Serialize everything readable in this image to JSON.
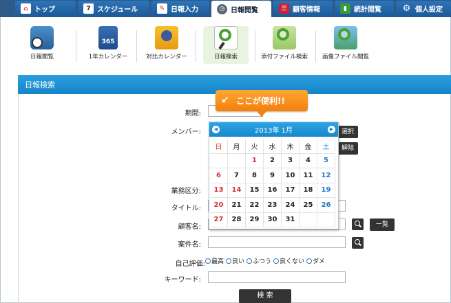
{
  "tabs": [
    {
      "label": "トップ",
      "icon": "home-icon",
      "active": false
    },
    {
      "label": "スケジュール",
      "icon": "calendar-icon",
      "active": false
    },
    {
      "label": "日報入力",
      "icon": "edit-icon",
      "active": false
    },
    {
      "label": "日報閲覧",
      "icon": "clock-icon",
      "active": true
    },
    {
      "label": "顧客情報",
      "icon": "customer-icon",
      "active": false
    },
    {
      "label": "統計閲覧",
      "icon": "stats-icon",
      "active": false
    },
    {
      "label": "個人設定",
      "icon": "gear-icon",
      "active": false
    }
  ],
  "toolbar": [
    {
      "label": "日報閲覧",
      "icon": "report-clock-icon"
    },
    {
      "label": "1年カレンダー",
      "icon": "year-calendar-icon",
      "badge": "365"
    },
    {
      "label": "対比カレンダー",
      "icon": "compare-calendar-icon"
    },
    {
      "label": "日報検索",
      "icon": "search-report-icon"
    },
    {
      "label": "添付ファイル検索",
      "icon": "attachment-search-icon"
    },
    {
      "label": "画像ファイル閲覧",
      "icon": "image-view-icon"
    }
  ],
  "section_title": "日報検索",
  "callout": "ここが便利!!",
  "form": {
    "period_label": "期間:",
    "member_label": "メンバー:",
    "select_button": "選択",
    "clear_button": "解除",
    "category_label": "業務区分:",
    "title_label": "タイトル:",
    "customer_label": "顧客名:",
    "list_button": "一覧",
    "project_label": "案件名:",
    "rating_label": "自己評価:",
    "ratings": [
      "最高",
      "良い",
      "ふつう",
      "良くない",
      "ダメ"
    ],
    "keyword_label": "キーワード:",
    "search_button": "検 索"
  },
  "calendar": {
    "title": "2013年 1月",
    "weekdays": [
      "日",
      "月",
      "火",
      "水",
      "木",
      "金",
      "土"
    ],
    "weeks": [
      [
        "",
        "",
        "1",
        "2",
        "3",
        "4",
        "5"
      ],
      [
        "6",
        "7",
        "8",
        "9",
        "10",
        "11",
        "12"
      ],
      [
        "13",
        "14",
        "15",
        "16",
        "17",
        "18",
        "19"
      ],
      [
        "20",
        "21",
        "22",
        "23",
        "24",
        "25",
        "26"
      ],
      [
        "27",
        "28",
        "29",
        "30",
        "31",
        "",
        ""
      ]
    ],
    "holidays": [
      "1",
      "14"
    ]
  },
  "colors": {
    "tab_bg": "#1d5a98",
    "section": "#1b8fd2",
    "callout": "#f5891a",
    "sunday": "#d43030",
    "saturday": "#1a79c8"
  }
}
